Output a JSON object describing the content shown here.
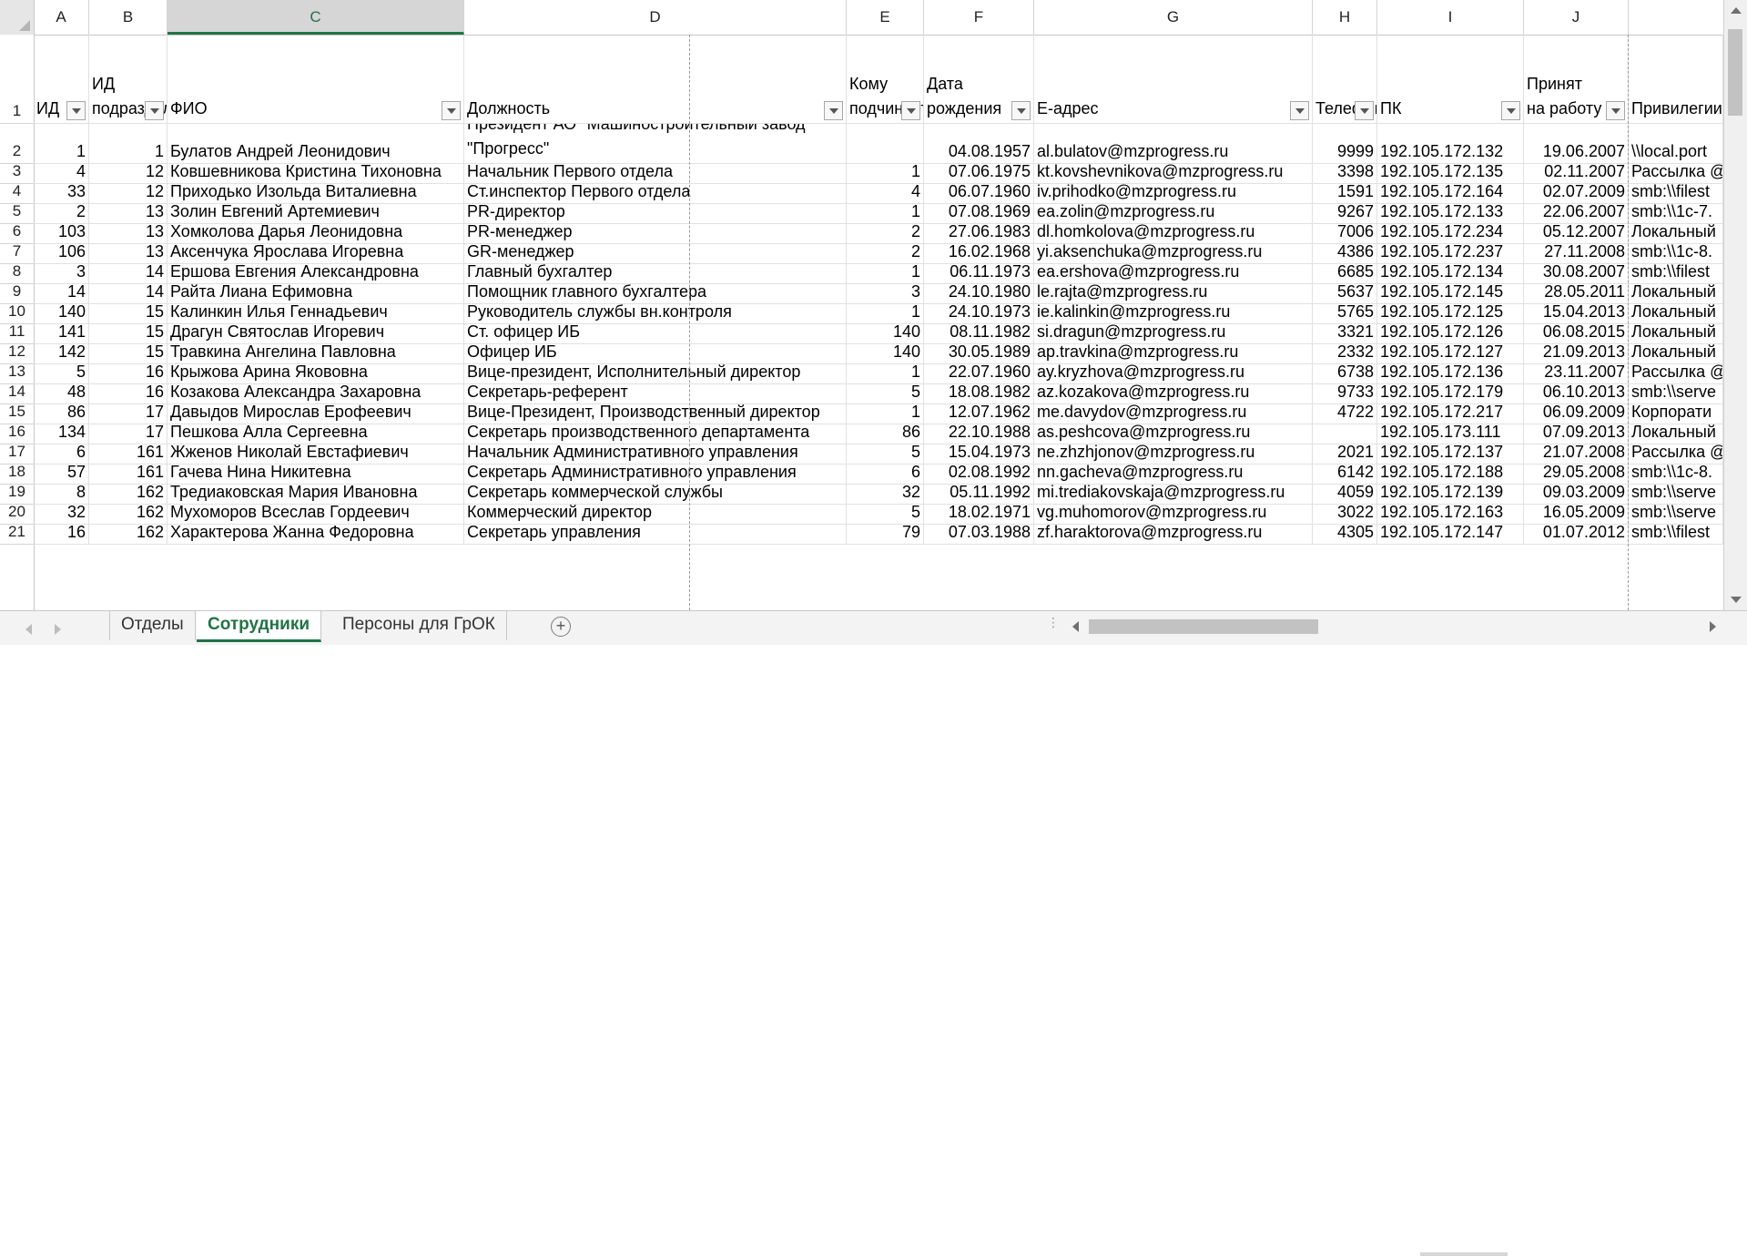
{
  "columns": [
    "A",
    "B",
    "C",
    "D",
    "E",
    "F",
    "G",
    "H",
    "I",
    "J"
  ],
  "selected_column": "C",
  "header_row": {
    "row_number": "1",
    "cells": [
      "ИД",
      "ИД подразделения",
      "ФИО",
      "Должность",
      "Кому подчиняется",
      "Дата рождения",
      "E-адрес",
      "Телефон",
      "ПК",
      "Принят на работу",
      "Привилегии"
    ]
  },
  "rows": [
    {
      "n": "2",
      "cells": [
        "1",
        "1",
        "Булатов Андрей Леонидович",
        "Президент АО \"Машиностроительный завод \"Прогресс\"",
        "",
        "04.08.1957",
        "al.bulatov@mzprogress.ru",
        "9999",
        "192.105.172.132",
        "19.06.2007",
        "\\\\local.port"
      ]
    },
    {
      "n": "3",
      "cells": [
        "4",
        "12",
        "Ковшевникова Кристина Тихоновна",
        "Начальник Первого отдела",
        "1",
        "07.06.1975",
        "kt.kovshevnikova@mzprogress.ru",
        "3398",
        "192.105.172.135",
        "02.11.2007",
        "Рассылка @"
      ]
    },
    {
      "n": "4",
      "cells": [
        "33",
        "12",
        "Приходько Изольда Виталиевна",
        "Ст.инспектор Первого отдела",
        "4",
        "06.07.1960",
        "iv.prihodko@mzprogress.ru",
        "1591",
        "192.105.172.164",
        "02.07.2009",
        "smb:\\\\filest"
      ]
    },
    {
      "n": "5",
      "cells": [
        "2",
        "13",
        "Золин Евгений Артемиевич",
        "PR-директор",
        "1",
        "07.08.1969",
        "ea.zolin@mzprogress.ru",
        "9267",
        "192.105.172.133",
        "22.06.2007",
        "smb:\\\\1c-7."
      ]
    },
    {
      "n": "6",
      "cells": [
        "103",
        "13",
        "Хомколова Дарья Леонидовна",
        "PR-менеджер",
        "2",
        "27.06.1983",
        "dl.homkolova@mzprogress.ru",
        "7006",
        "192.105.172.234",
        "05.12.2007",
        "Локальный"
      ]
    },
    {
      "n": "7",
      "cells": [
        "106",
        "13",
        "Аксенчука Ярослава Игоревна",
        "GR-менеджер",
        "2",
        "16.02.1968",
        "yi.aksenchuka@mzprogress.ru",
        "4386",
        "192.105.172.237",
        "27.11.2008",
        "smb:\\\\1c-8."
      ]
    },
    {
      "n": "8",
      "cells": [
        "3",
        "14",
        "Ершова Евгения Александровна",
        "Главный бухгалтер",
        "1",
        "06.11.1973",
        "ea.ershova@mzprogress.ru",
        "6685",
        "192.105.172.134",
        "30.08.2007",
        "smb:\\\\filest"
      ]
    },
    {
      "n": "9",
      "cells": [
        "14",
        "14",
        "Райта Лиана Ефимовна",
        "Помощник главного бухгалтера",
        "3",
        "24.10.1980",
        "le.rajta@mzprogress.ru",
        "5637",
        "192.105.172.145",
        "28.05.2011",
        "Локальный"
      ]
    },
    {
      "n": "10",
      "cells": [
        "140",
        "15",
        "Калинкин Илья Геннадьевич",
        "Руководитель службы вн.контроля",
        "1",
        "24.10.1973",
        "ie.kalinkin@mzprogress.ru",
        "5765",
        "192.105.172.125",
        "15.04.2013",
        "Локальный"
      ]
    },
    {
      "n": "11",
      "cells": [
        "141",
        "15",
        "Драгун Святослав Игоревич",
        "Ст. офицер ИБ",
        "140",
        "08.11.1982",
        "si.dragun@mzprogress.ru",
        "3321",
        "192.105.172.126",
        "06.08.2015",
        "Локальный"
      ]
    },
    {
      "n": "12",
      "cells": [
        "142",
        "15",
        "Травкина Ангелина Павловна",
        "Офицер ИБ",
        "140",
        "30.05.1989",
        "ap.travkina@mzprogress.ru",
        "2332",
        "192.105.172.127",
        "21.09.2013",
        "Локальный"
      ]
    },
    {
      "n": "13",
      "cells": [
        "5",
        "16",
        "Крыжова Арина Якововна",
        "Вице-президент, Исполнительный директор",
        "1",
        "22.07.1960",
        "ay.kryzhova@mzprogress.ru",
        "6738",
        "192.105.172.136",
        "23.11.2007",
        "Рассылка @"
      ]
    },
    {
      "n": "14",
      "cells": [
        "48",
        "16",
        "Козакова Александра Захаровна",
        "Секретарь-референт",
        "5",
        "18.08.1982",
        "az.kozakova@mzprogress.ru",
        "9733",
        "192.105.172.179",
        "06.10.2013",
        "smb:\\\\serve"
      ]
    },
    {
      "n": "15",
      "cells": [
        "86",
        "17",
        "Давыдов Мирослав Ерофеевич",
        "Вице-Президент, Производственный директор",
        "1",
        "12.07.1962",
        "me.davydov@mzprogress.ru",
        "4722",
        "192.105.172.217",
        "06.09.2009",
        "Корпорати"
      ]
    },
    {
      "n": "16",
      "cells": [
        "134",
        "17",
        "Пешкова Алла Сергеевна",
        "Секретарь производственного департамента",
        "86",
        "22.10.1988",
        "as.peshcova@mzprogress.ru",
        "",
        "192.105.173.111",
        "07.09.2013",
        "Локальный"
      ]
    },
    {
      "n": "17",
      "cells": [
        "6",
        "161",
        "Жженов Николай Евстафиевич",
        "Начальник Административного управления",
        "5",
        "15.04.1973",
        "ne.zhzhjonov@mzprogress.ru",
        "2021",
        "192.105.172.137",
        "21.07.2008",
        "Рассылка @"
      ]
    },
    {
      "n": "18",
      "cells": [
        "57",
        "161",
        "Гачева Нина Никитевна",
        "Секретарь Административного управления",
        "6",
        "02.08.1992",
        "nn.gacheva@mzprogress.ru",
        "6142",
        "192.105.172.188",
        "29.05.2008",
        "smb:\\\\1c-8."
      ]
    },
    {
      "n": "19",
      "cells": [
        "8",
        "162",
        "Тредиаковская Мария Ивановна",
        "Секретарь коммерческой службы",
        "32",
        "05.11.1992",
        "mi.trediakovskaja@mzprogress.ru",
        "4059",
        "192.105.172.139",
        "09.03.2009",
        "smb:\\\\serve"
      ]
    },
    {
      "n": "20",
      "cells": [
        "32",
        "162",
        "Мухоморов Всеслав Гордеевич",
        "Коммерческий директор",
        "5",
        "18.02.1971",
        "vg.muhomorov@mzprogress.ru",
        "3022",
        "192.105.172.163",
        "16.05.2009",
        "smb:\\\\serve"
      ]
    },
    {
      "n": "21",
      "cells": [
        "16",
        "162",
        "Характерова Жанна Федоровна",
        "Секретарь управления",
        "79",
        "07.03.1988",
        "zf.haraktorova@mzprogress.ru",
        "4305",
        "192.105.172.147",
        "01.07.2012",
        "smb:\\\\filest"
      ]
    }
  ],
  "sheet_tabs": [
    {
      "label": "Отделы",
      "active": false
    },
    {
      "label": "Сотрудники",
      "active": true
    },
    {
      "label": "Персоны для ГрОК",
      "active": false
    }
  ],
  "add_sheet_label": "+",
  "colors": {
    "accent": "#217346",
    "header_bg": "#e6e6e6",
    "grid_line": "#e1e1e1"
  }
}
